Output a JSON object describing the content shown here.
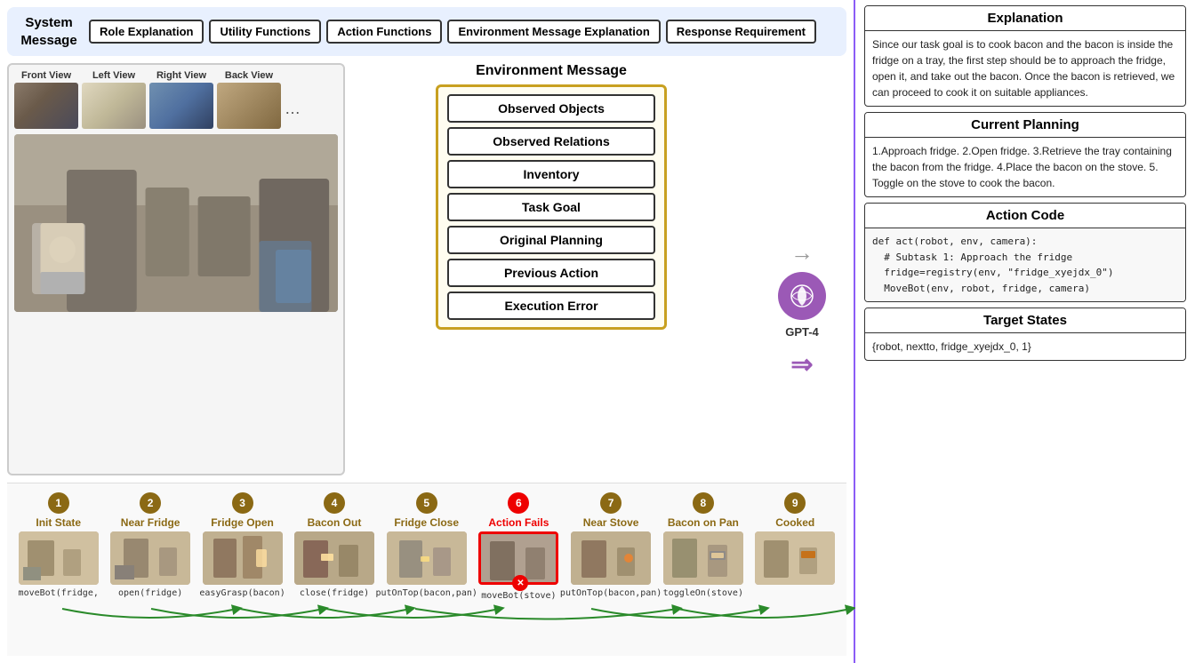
{
  "systemMessage": {
    "label": "System\nMessage",
    "tags": [
      "Role Explanation",
      "Utility Functions",
      "Action Functions",
      "Environment Message Explanation",
      "Response Requirement"
    ]
  },
  "views": {
    "thumbnails": [
      {
        "label": "Front View"
      },
      {
        "label": "Left View"
      },
      {
        "label": "Right View"
      },
      {
        "label": "Back View"
      }
    ]
  },
  "envMessage": {
    "title": "Environment Message",
    "items": [
      "Observed Objects",
      "Observed Relations",
      "Inventory",
      "Task Goal",
      "Original Planning",
      "Previous Action",
      "Execution Error"
    ]
  },
  "gpt": {
    "label": "GPT-4",
    "icon": "✦"
  },
  "rightPanel": {
    "explanation": {
      "title": "Explanation",
      "body": "Since our task goal is to cook bacon and the bacon is inside the fridge on a tray, the first step should be to approach the fridge, open it, and take out the bacon. Once the bacon is retrieved, we can proceed to cook it on suitable appliances."
    },
    "currentPlanning": {
      "title": "Current Planning",
      "body": "1.Approach fridge. 2.Open fridge. 3.Retrieve the tray containing the bacon from the fridge. 4.Place the bacon on the stove. 5. Toggle on the stove to cook the bacon."
    },
    "actionCode": {
      "title": "Action Code",
      "body": "def act(robot, env, camera):\n  # Subtask 1: Approach the fridge\n  fridge=registry(env, \"fridge_xyejdx_0\")\n  MoveBot(env, robot, fridge, camera)"
    },
    "targetStates": {
      "title": "Target States",
      "body": "{robot, nextto, fridge_xyejdx_0, 1}"
    }
  },
  "timeline": {
    "steps": [
      {
        "num": "1",
        "label": "Init State",
        "fail": false
      },
      {
        "num": "2",
        "label": "Near Fridge",
        "fail": false
      },
      {
        "num": "3",
        "label": "Fridge Open",
        "fail": false
      },
      {
        "num": "4",
        "label": "Bacon Out",
        "fail": false
      },
      {
        "num": "5",
        "label": "Fridge Close",
        "fail": false
      },
      {
        "num": "6",
        "label": "Action Fails",
        "fail": true
      },
      {
        "num": "7",
        "label": "Near Stove",
        "fail": false
      },
      {
        "num": "8",
        "label": "Bacon on Pan",
        "fail": false
      },
      {
        "num": "9",
        "label": "Cooked",
        "fail": false
      }
    ],
    "actions": [
      {
        "lines": [
          "moveBot(fridge,",
          ""
        ]
      },
      {
        "lines": [
          "",
          "open(fridge)"
        ]
      },
      {
        "lines": [
          "easyGrasp(bacon)",
          ""
        ]
      },
      {
        "lines": [
          "",
          "close(fridge)"
        ]
      },
      {
        "lines": [
          "putOnTop(bacon,pan)",
          ""
        ]
      },
      {
        "lines": [
          "",
          "moveBot(stove)"
        ]
      },
      {
        "lines": [
          "putOnTop(bacon,pan)",
          ""
        ]
      },
      {
        "lines": [
          "",
          "toggleOn(stove)"
        ]
      },
      {
        "lines": [
          "",
          ""
        ]
      }
    ]
  }
}
